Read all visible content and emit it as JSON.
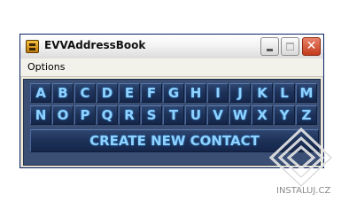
{
  "window": {
    "title": "EVVAddressBook",
    "buttons": {
      "close_label": "✕"
    }
  },
  "menu": {
    "items": [
      "Options"
    ]
  },
  "letters": {
    "row1": [
      "A",
      "B",
      "C",
      "D",
      "E",
      "F",
      "G",
      "H",
      "I",
      "J",
      "K",
      "L",
      "M"
    ],
    "row2": [
      "N",
      "O",
      "P",
      "Q",
      "R",
      "S",
      "T",
      "U",
      "V",
      "W",
      "X",
      "Y",
      "Z"
    ]
  },
  "actions": {
    "create_label": "CREATE NEW CONTACT"
  },
  "watermark": {
    "text": "INSTALUJ.CZ"
  },
  "colors": {
    "panel": "#3a4f73",
    "button_text": "#8fd2ff"
  }
}
